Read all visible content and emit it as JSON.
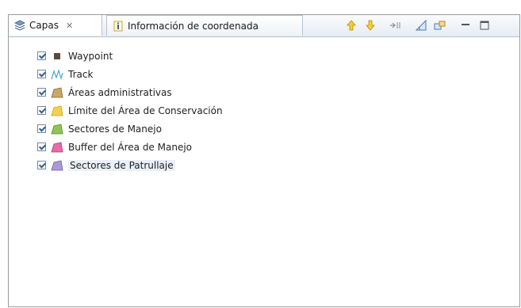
{
  "tabs": [
    {
      "label": "Capas",
      "close": "✕",
      "active": true,
      "icon": "layers-icon"
    },
    {
      "label": "Información de coordenada",
      "active": false,
      "icon": "info-icon"
    }
  ],
  "toolbar": [
    {
      "name": "move-up-icon",
      "color": "#e8b400"
    },
    {
      "name": "move-down-icon",
      "color": "#e8b400"
    },
    {
      "name": "collapse-icon",
      "color": "#8a8a8a"
    },
    {
      "name": "add-layer-icon",
      "color": "#4a7ab5"
    },
    {
      "name": "link-icon",
      "color": "#4a7ab5"
    },
    {
      "name": "minimize-icon",
      "color": "#555555"
    },
    {
      "name": "maximize-icon",
      "color": "#555555"
    }
  ],
  "layers": [
    {
      "label": "Waypoint",
      "icon": "waypoint-icon",
      "color": "#5a4a3a",
      "checked": true
    },
    {
      "label": "Track",
      "icon": "track-icon",
      "color": "#4aa6c8",
      "checked": true
    },
    {
      "label": "Áreas administrativas",
      "icon": "polygon-icon",
      "color": "#b49058",
      "checked": true
    },
    {
      "label": "Límite del Área de Conservación",
      "icon": "polygon-icon",
      "color": "#f2d14e",
      "checked": true
    },
    {
      "label": "Sectores de Manejo",
      "icon": "polygon-icon",
      "color": "#8ec45a",
      "checked": true
    },
    {
      "label": "Buffer del Área de Manejo",
      "icon": "polygon-icon",
      "color": "#e86aa8",
      "checked": true
    },
    {
      "label": "Sectores de Patrullaje",
      "icon": "polygon-icon",
      "color": "#a99ad6",
      "checked": true
    }
  ]
}
